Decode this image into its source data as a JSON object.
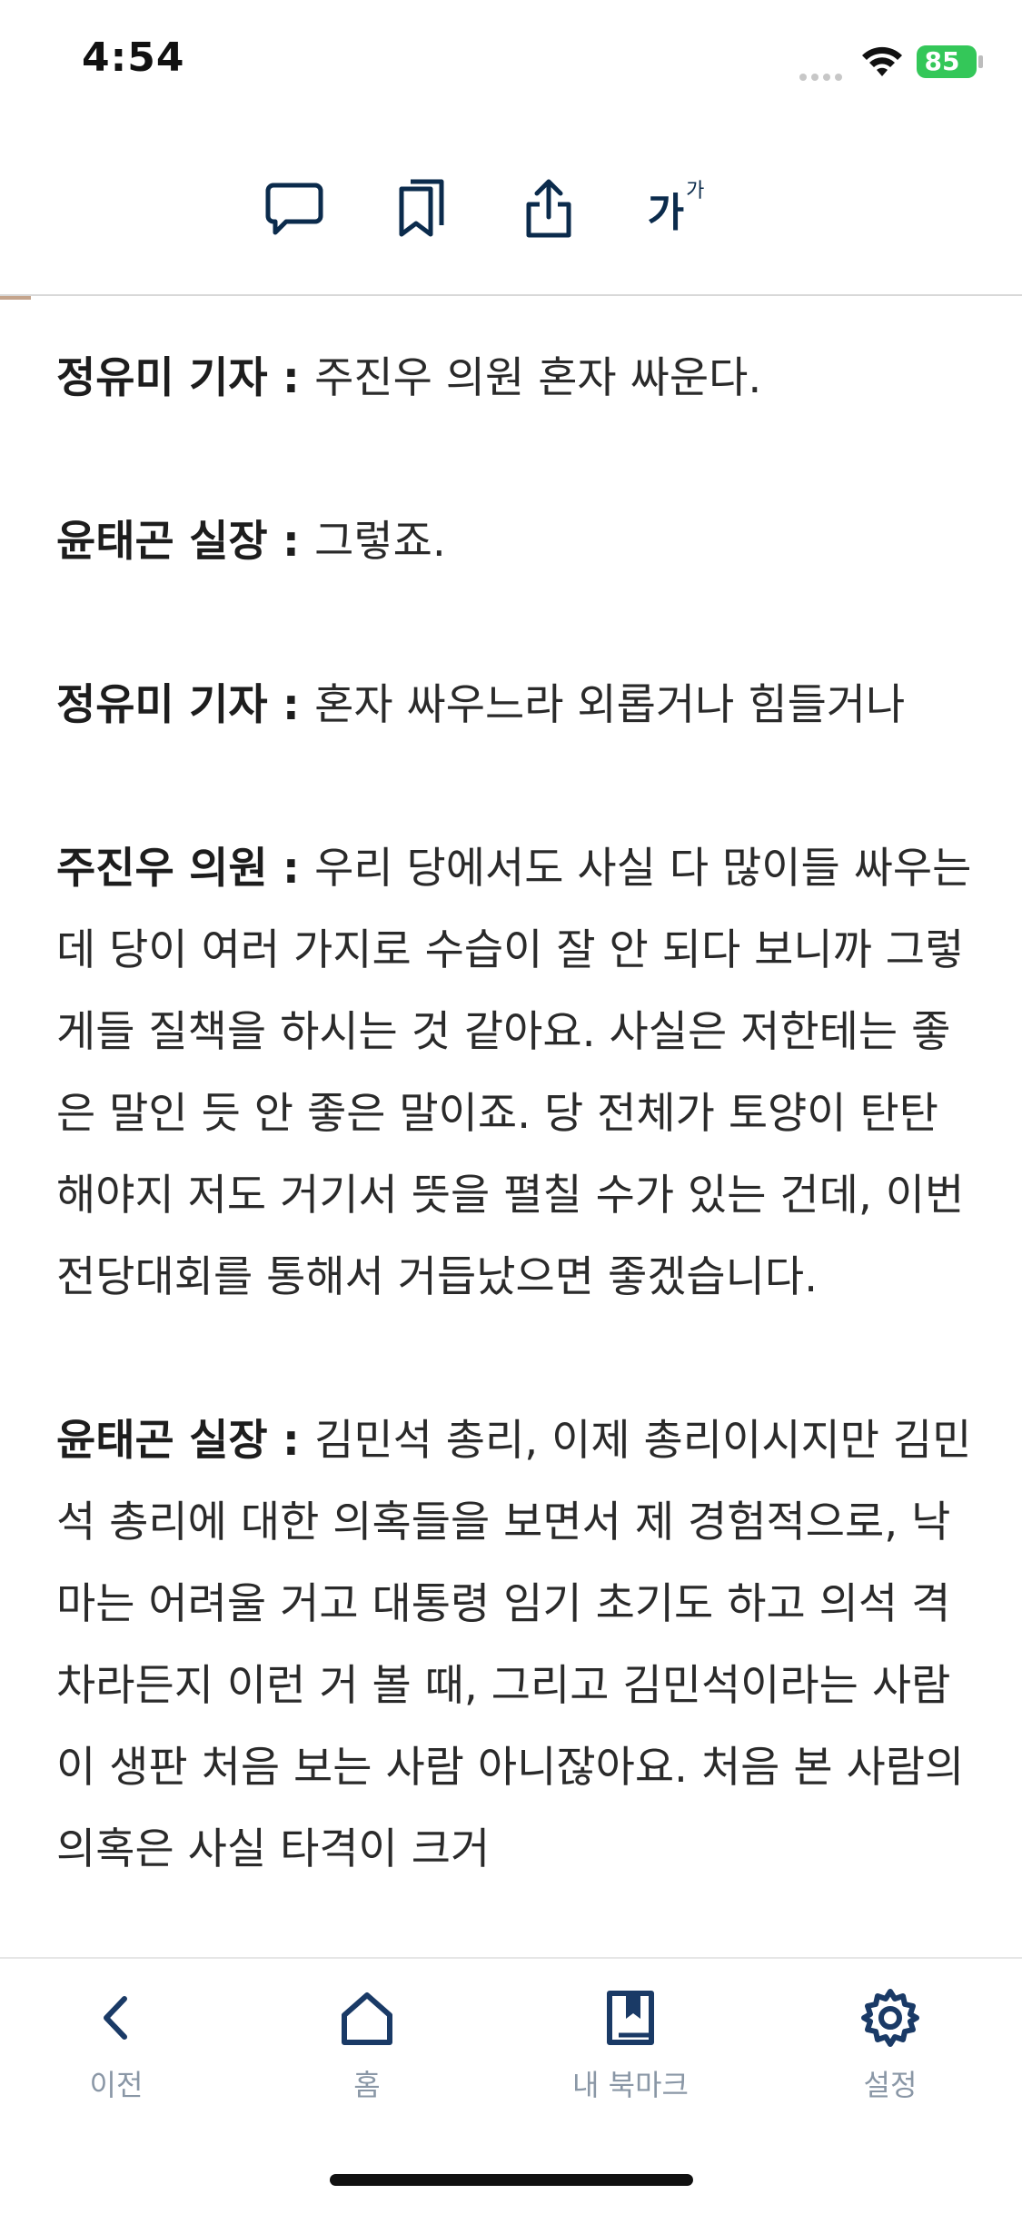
{
  "status_bar": {
    "time": "4:54",
    "battery": "85"
  },
  "toolbar": {
    "icons": [
      "comment-icon",
      "bookmark-icon",
      "share-icon",
      "font-size-icon"
    ],
    "font_size_label": "가",
    "font_size_super": "가"
  },
  "reading_progress": 0.03,
  "article": {
    "paragraphs": [
      {
        "speaker": "정유미 기자",
        "text": "주진우 의원 혼자 싸운다."
      },
      {
        "speaker": "윤태곤 실장",
        "text": "그렇죠."
      },
      {
        "speaker": "정유미 기자",
        "text": "혼자 싸우느라 외롭거나 힘들거나"
      },
      {
        "speaker": "주진우 의원",
        "text": "우리 당에서도 사실 다 많이들 싸우는데 당이 여러 가지로 수습이 잘 안 되다 보니까 그렇게들 질책을 하시는 것 같아요. 사실은 저한테는 좋은 말인 듯 안 좋은 말이죠. 당 전체가 토양이 탄탄해야지 저도 거기서 뜻을 펼칠 수가 있는 건데, 이번 전당대회를 통해서 거듭났으면 좋겠습니다."
      },
      {
        "speaker": "윤태곤 실장",
        "text": "김민석 총리, 이제 총리이시지만 김민석 총리에 대한 의혹들을 보면서 제 경험적으로, 낙마는 어려울 거고 대통령 임기 초기도 하고 의석 격차라든지 이런 거 볼 때, 그리고 김민석이라는 사람이 생판 처음 보는 사람 아니잖아요. 처음 본 사람의 의혹은 사실 타격이 크거"
      }
    ],
    "separator": " : "
  },
  "tabbar": {
    "tabs": [
      {
        "label": "이전",
        "icon": "chevron-left-icon"
      },
      {
        "label": "홈",
        "icon": "home-icon"
      },
      {
        "label": "내 북마크",
        "icon": "book-bookmark-icon"
      },
      {
        "label": "설정",
        "icon": "gear-icon"
      }
    ]
  },
  "colors": {
    "icon_navy": "#0b2b4c",
    "tab_icon": "#1a3a66",
    "tab_label": "#8a97a6",
    "progress": "#c4a48c",
    "battery": "#34c759"
  }
}
